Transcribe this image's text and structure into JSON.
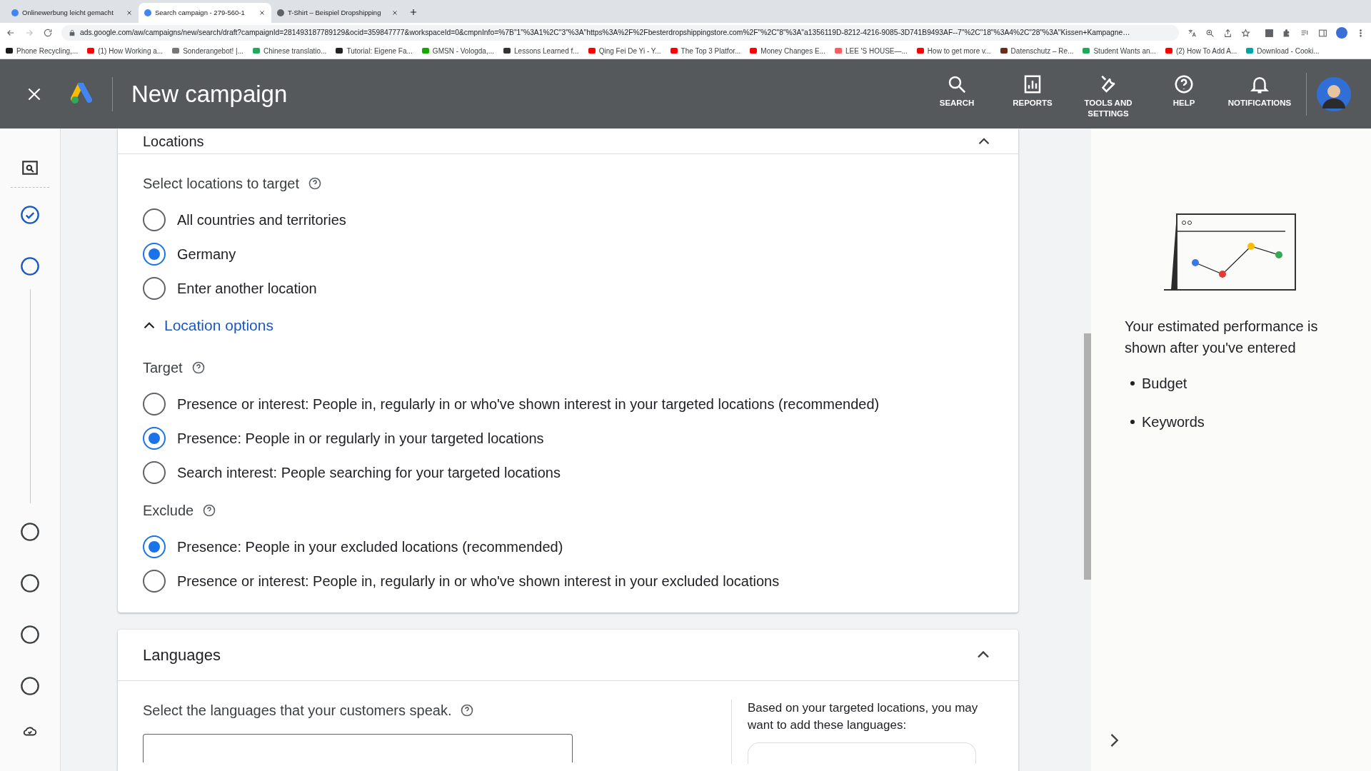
{
  "browser": {
    "tabs": [
      {
        "title": "Onlinewerbung leicht gemacht",
        "selected": false,
        "color": "#4285f4"
      },
      {
        "title": "Search campaign - 279-560-1",
        "selected": true,
        "color": "#4285f4"
      },
      {
        "title": "T-Shirt – Beispiel Dropshipping",
        "selected": false,
        "color": "#5f6368"
      }
    ],
    "url": "ads.google.com/aw/campaigns/new/search/draft?campaignId=281493187789129&ocid=359847777&workspaceId=0&cmpnInfo=%7B\"1\"%3A1%2C\"3\"%3A\"https%3A%2F%2Fbesterdropshippingstore.com%2F\"%2C\"8\"%3A\"a1356119D-8212-4216-9085-3D741B9493AF--7\"%2C\"18\"%3A4%2C\"28\"%3A\"Kissen+Kampagne…",
    "bookmarks": [
      {
        "label": "Phone Recycling,...",
        "color": "#1a1a1a"
      },
      {
        "label": "(1) How Working a...",
        "color": "#ff0000"
      },
      {
        "label": "Sonderangebot! |...",
        "color": "#777777"
      },
      {
        "label": "Chinese translatio...",
        "color": "#1faa59"
      },
      {
        "label": "Tutorial: Eigene Fa...",
        "color": "#222222"
      },
      {
        "label": "GMSN - Vologda,...",
        "color": "#14a800"
      },
      {
        "label": "Lessons Learned f...",
        "color": "#333333"
      },
      {
        "label": "Qing Fei De Yi - Y...",
        "color": "#ff0000"
      },
      {
        "label": "The Top 3 Platfor...",
        "color": "#ff0000"
      },
      {
        "label": "Money Changes E...",
        "color": "#ff0000"
      },
      {
        "label": "LEE 'S HOUSE—...",
        "color": "#ff5a5f"
      },
      {
        "label": "How to get more v...",
        "color": "#ff0000"
      },
      {
        "label": "Datenschutz – Re...",
        "color": "#6b2a1a"
      },
      {
        "label": "Student Wants an...",
        "color": "#1faa59"
      },
      {
        "label": "(2) How To Add A...",
        "color": "#ff0000"
      },
      {
        "label": "Download - Cooki...",
        "color": "#00a5a5"
      }
    ]
  },
  "header": {
    "title": "New campaign",
    "actions": [
      {
        "kind": "search",
        "label": "SEARCH"
      },
      {
        "kind": "reports",
        "label": "REPORTS"
      },
      {
        "kind": "tools",
        "label": "TOOLS AND SETTINGS"
      },
      {
        "kind": "help",
        "label": "HELP"
      },
      {
        "kind": "notifications",
        "label": "NOTIFICATIONS"
      }
    ]
  },
  "steps": [
    {
      "kind": "done"
    },
    {
      "kind": "current"
    },
    {
      "kind": "todo"
    },
    {
      "kind": "todo"
    },
    {
      "kind": "todo"
    },
    {
      "kind": "todo"
    }
  ],
  "locations": {
    "title": "Locations",
    "prompt": "Select locations to target",
    "options": [
      {
        "label": "All countries and territories",
        "selected": false
      },
      {
        "label": "Germany",
        "selected": true
      },
      {
        "label": "Enter another location",
        "selected": false
      }
    ],
    "location_options": {
      "label": "Location options",
      "expanded": true
    },
    "target": {
      "label": "Target",
      "options": [
        {
          "label": "Presence or interest: People in, regularly in or who've shown interest in your targeted locations (recommended)",
          "selected": false
        },
        {
          "label": "Presence: People in or regularly in your targeted locations",
          "selected": true
        },
        {
          "label": "Search interest: People searching for your targeted locations",
          "selected": false
        }
      ]
    },
    "exclude": {
      "label": "Exclude",
      "options": [
        {
          "label": "Presence: People in your excluded locations (recommended)",
          "selected": true
        },
        {
          "label": "Presence or interest: People in, regularly in or who've shown interest in your excluded locations",
          "selected": false
        }
      ]
    }
  },
  "languages": {
    "title": "Languages",
    "expanded": true,
    "prompt": "Select the languages that your customers speak.",
    "suggestion": "Based on your targeted locations, you may want to add these languages:"
  },
  "performance": {
    "text": "Your estimated performance is shown after you've entered",
    "items": [
      "Budget",
      "Keywords"
    ]
  }
}
